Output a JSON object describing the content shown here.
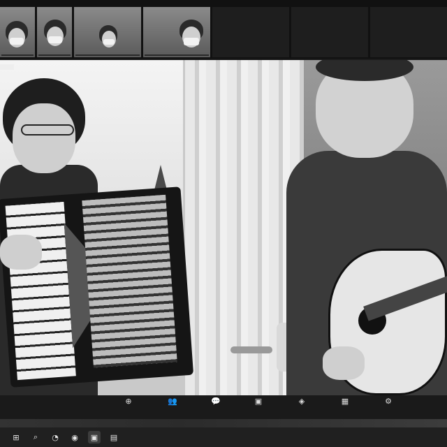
{
  "filmstrip": {
    "captions": [
      "",
      "",
      "",
      ""
    ],
    "name_tiles": [
      "",
      "",
      "",
      ""
    ]
  },
  "toolbar": {
    "items": [
      {
        "icon": "share-screen-icon",
        "label": ""
      },
      {
        "icon": "participants-icon",
        "label": ""
      },
      {
        "icon": "chat-icon",
        "label": ""
      },
      {
        "icon": "record-icon",
        "label": ""
      },
      {
        "icon": "reactions-icon",
        "label": ""
      },
      {
        "icon": "apps-icon",
        "label": ""
      },
      {
        "icon": "more-icon",
        "label": ""
      }
    ]
  },
  "taskbar": {
    "items": [
      {
        "icon": "start-icon"
      },
      {
        "icon": "search-icon"
      },
      {
        "icon": "browser-icon"
      },
      {
        "icon": "chrome-icon"
      },
      {
        "icon": "zoom-app-icon",
        "active": true
      },
      {
        "icon": "windows-icon"
      }
    ]
  }
}
